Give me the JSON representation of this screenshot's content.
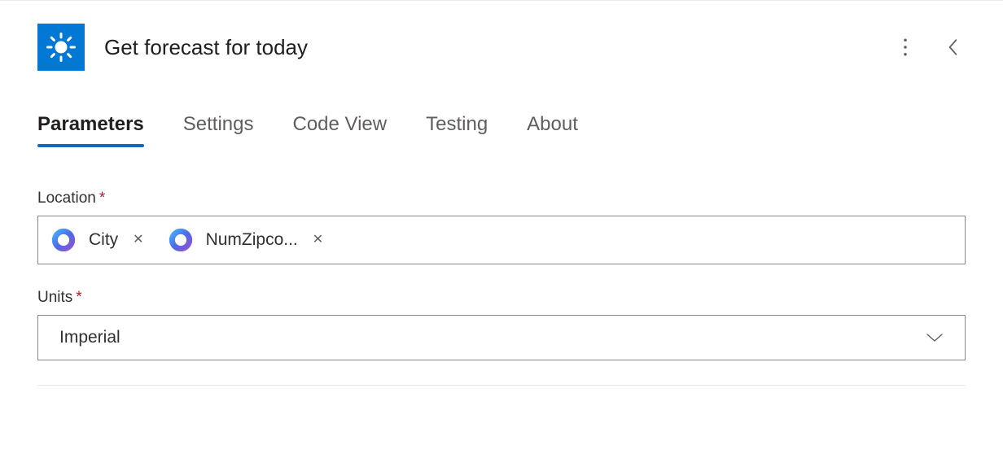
{
  "header": {
    "title": "Get forecast for today"
  },
  "tabs": [
    {
      "label": "Parameters",
      "active": true
    },
    {
      "label": "Settings",
      "active": false
    },
    {
      "label": "Code View",
      "active": false
    },
    {
      "label": "Testing",
      "active": false
    },
    {
      "label": "About",
      "active": false
    }
  ],
  "form": {
    "location": {
      "label": "Location",
      "required_mark": "*",
      "tokens": [
        {
          "label": "City"
        },
        {
          "label": "NumZipco..."
        }
      ]
    },
    "units": {
      "label": "Units",
      "required_mark": "*",
      "value": "Imperial"
    }
  }
}
